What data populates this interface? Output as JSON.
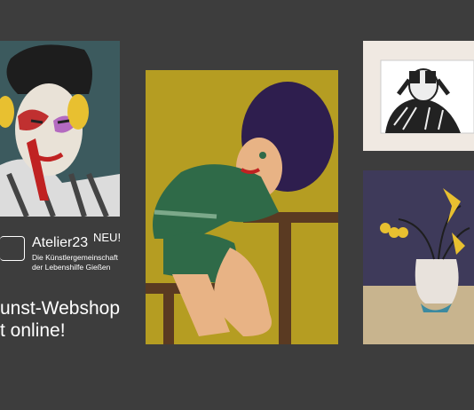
{
  "badge": "NEU!",
  "brand": {
    "name": "Atelier23",
    "desc_line1": "Die Künstlergemeinschaft",
    "desc_line2": "der Lebenshilfe Gießen"
  },
  "headline": {
    "line1": "unst-Webshop",
    "line2": "t online!"
  },
  "colors": {
    "background": "#3d3d3d",
    "text": "#ffffff"
  },
  "icons": [
    "atelier23-logo-icon"
  ],
  "artworks": [
    "portrait-painting",
    "seated-figure-painting",
    "binoculars-print",
    "still-life-painting"
  ]
}
